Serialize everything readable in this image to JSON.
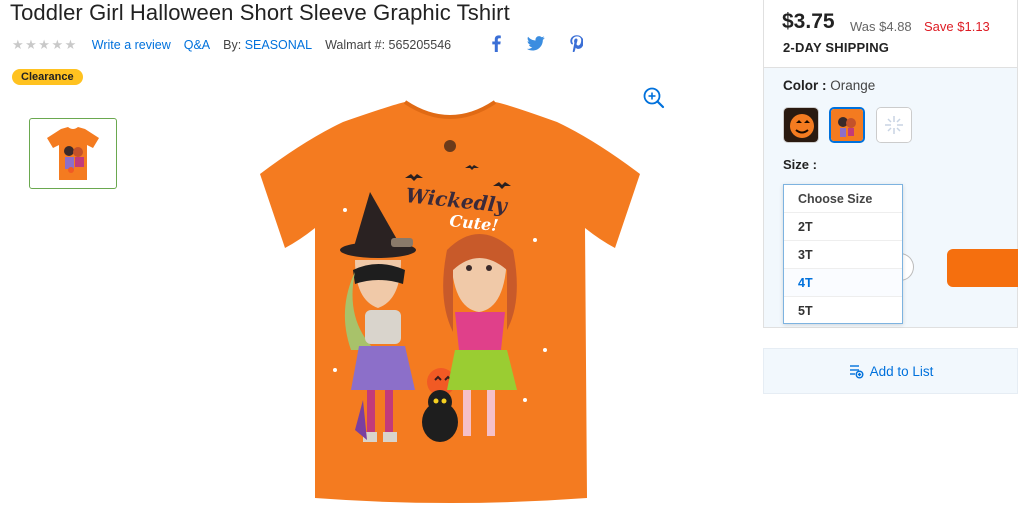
{
  "product": {
    "title": "Toddler Girl Halloween Short Sleeve Graphic Tshirt",
    "rating_stars": "★★★★★",
    "write_review": "Write a review",
    "qa": "Q&A",
    "by_label": "By:",
    "brand": "SEASONAL",
    "walmart_number_label": "Walmart #:",
    "walmart_number": "565205546",
    "badge": "Clearance",
    "image_text": "Wickedly Cute!"
  },
  "social": {
    "facebook": "f",
    "twitter_icon": "twitter-bird-icon",
    "pinterest": "p"
  },
  "pricing": {
    "price": "$3.75",
    "was": "Was $4.88",
    "save": "Save $1.13",
    "shipping": "2-DAY SHIPPING"
  },
  "options": {
    "color_label": "Color :",
    "color_value": "Orange",
    "size_label": "Size :",
    "size_options": [
      "Choose Size",
      "2T",
      "3T",
      "4T",
      "5T"
    ],
    "highlighted_size": "4T"
  },
  "list": {
    "add_to_list": "Add to List"
  },
  "colors": {
    "accent": "#0071dc",
    "shirt": "#f47b20",
    "add_cart": "#f56f0e",
    "save_red": "#de1c24",
    "clearance_yellow": "#ffc220"
  }
}
